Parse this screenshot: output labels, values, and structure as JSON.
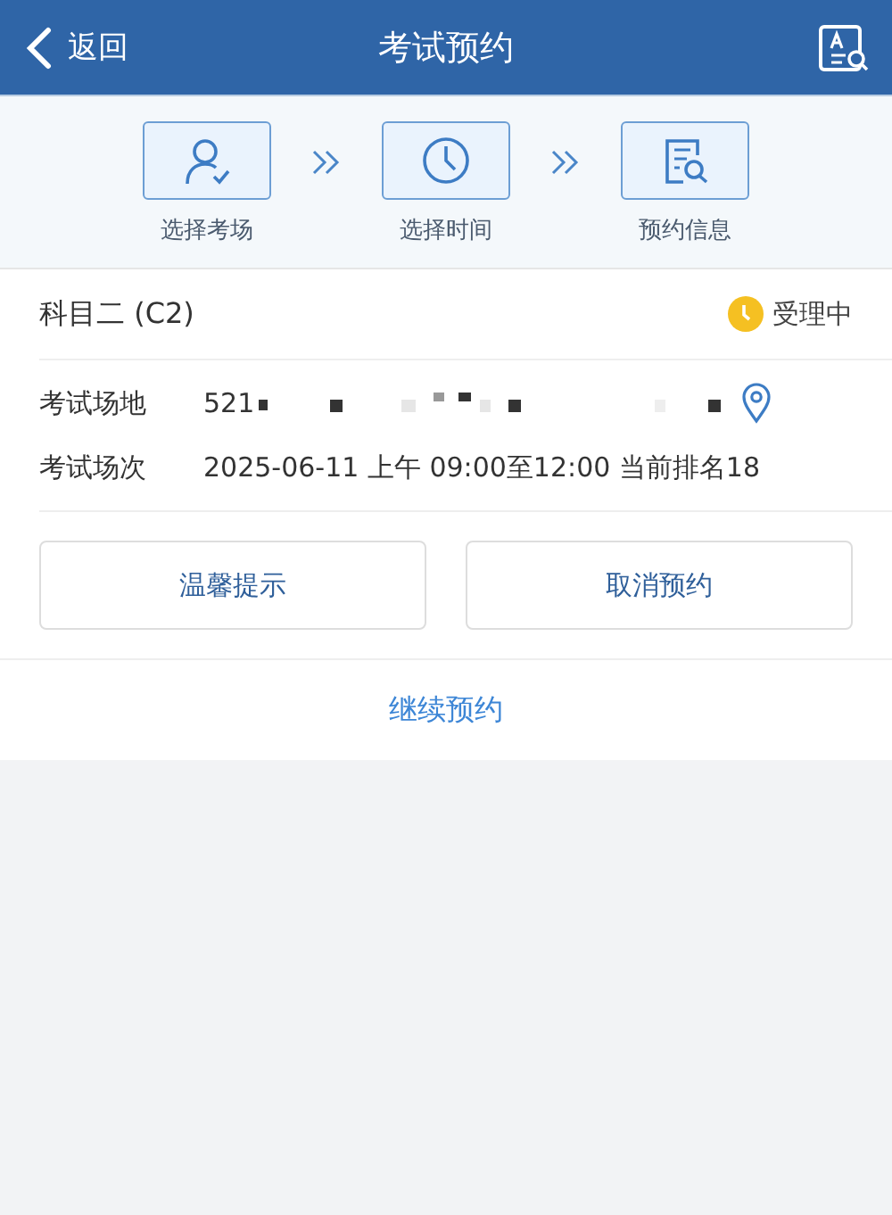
{
  "nav": {
    "back": "返回",
    "title": "考试预约"
  },
  "steps": [
    {
      "label": "选择考场",
      "kind": "person"
    },
    {
      "label": "选择时间",
      "kind": "clock"
    },
    {
      "label": "预约信息",
      "kind": "doc"
    }
  ],
  "card": {
    "subject": "科目二 (C2)",
    "status": "受理中",
    "rows": [
      {
        "label": "考试场地",
        "value": "521",
        "kind": "place"
      },
      {
        "label": "考试场次",
        "value": "2025-06-11 上午 09:00至12:00 当前排名18",
        "kind": "text"
      }
    ],
    "buttons": [
      "温馨提示",
      "取消预约"
    ],
    "link": "继续预约"
  }
}
